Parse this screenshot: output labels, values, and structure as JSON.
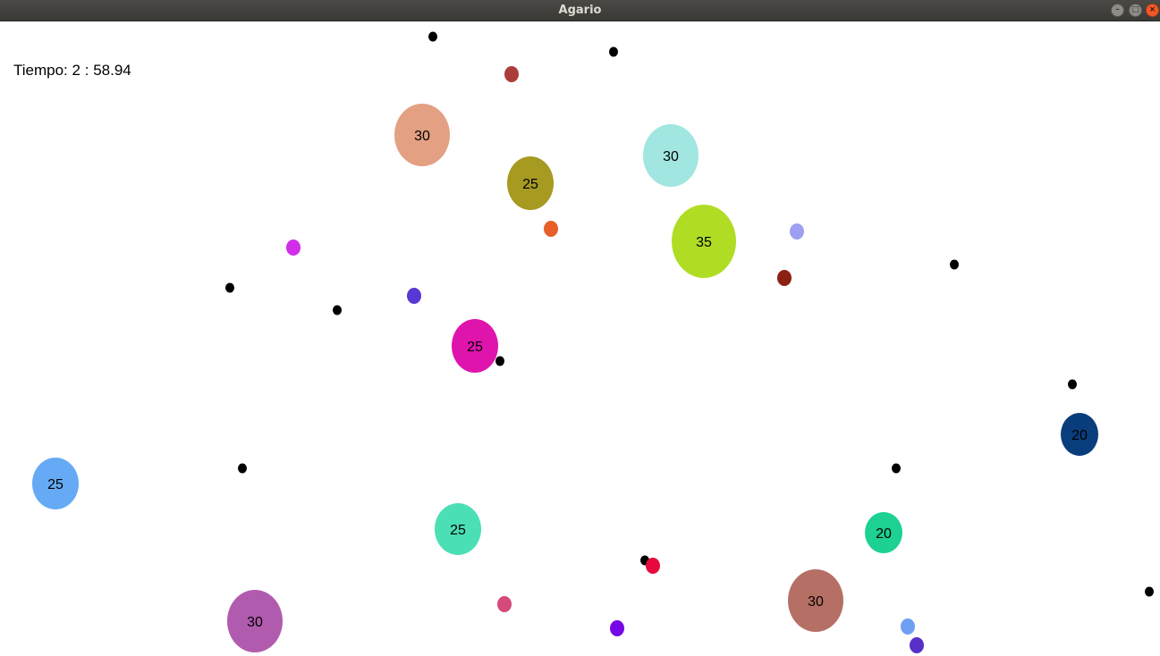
{
  "window": {
    "title": "Agario"
  },
  "hud": {
    "timer_label": "Tiempo:",
    "minutes": "2",
    "separator": ":",
    "seconds": "58.94"
  },
  "players": [
    {
      "label": "30",
      "color": "#e3a083"
    },
    {
      "label": "25",
      "color": "#a69a21"
    },
    {
      "label": "30",
      "color": "#a1e6e0"
    },
    {
      "label": "35",
      "color": "#b0dd23"
    },
    {
      "label": "25",
      "color": "#de14ad"
    },
    {
      "label": "20",
      "color": "#0a3d7c"
    },
    {
      "label": "25",
      "color": "#66aaf6"
    },
    {
      "label": "25",
      "color": "#4adfb5"
    },
    {
      "label": "20",
      "color": "#1cd192"
    },
    {
      "label": "30",
      "color": "#b66f64"
    },
    {
      "label": "30",
      "color": "#b15baf"
    }
  ],
  "food": [
    {
      "color": "#ab3d3a"
    },
    {
      "color": "#e95f2a"
    },
    {
      "color": "#d12ee9"
    },
    {
      "color": "#9d9ff0"
    },
    {
      "color": "#5837d4"
    },
    {
      "color": "#8c2113"
    },
    {
      "color": "#e8093c"
    },
    {
      "color": "#d5497c"
    },
    {
      "color": "#7708e6"
    },
    {
      "color": "#6e9ff2"
    },
    {
      "color": "#5730c6"
    }
  ],
  "pellets": {
    "count": 14,
    "color": "#000000"
  }
}
